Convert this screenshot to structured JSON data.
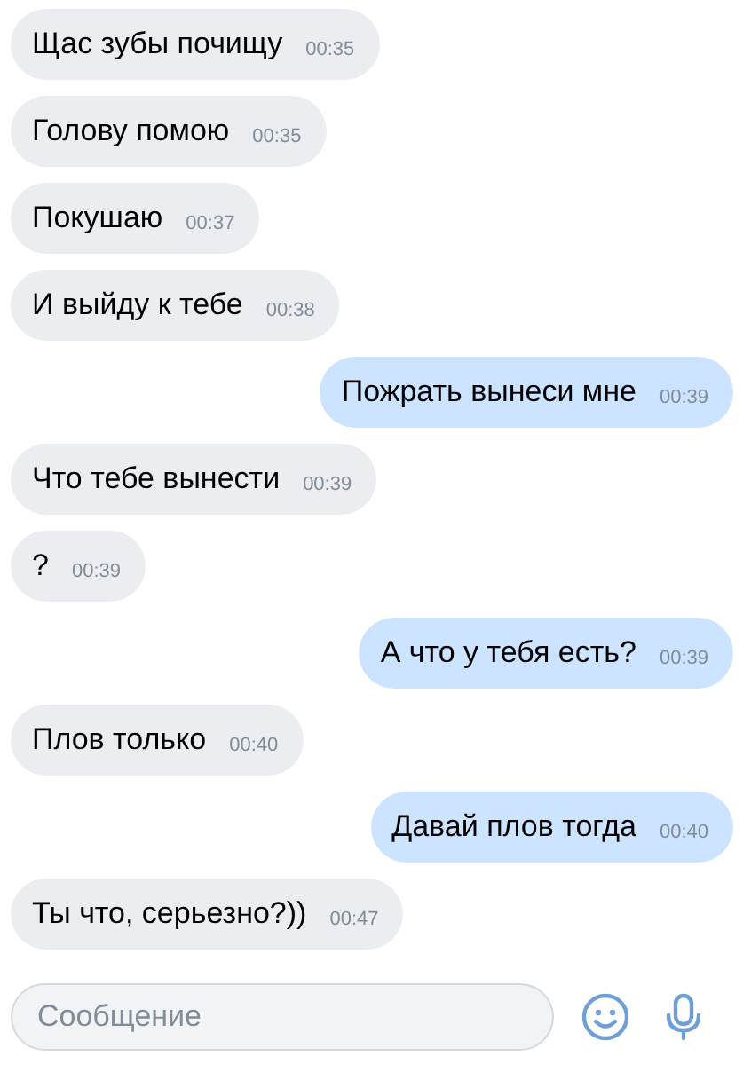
{
  "messages": [
    {
      "kind": "in",
      "text": "Щас зубы почищу",
      "time": "00:35"
    },
    {
      "kind": "in",
      "text": "Голову помою",
      "time": "00:35"
    },
    {
      "kind": "in",
      "text": "Покушаю",
      "time": "00:37"
    },
    {
      "kind": "in",
      "text": "И выйду к тебе",
      "time": "00:38"
    },
    {
      "kind": "out",
      "text": "Пожрать вынеси мне",
      "time": "00:39"
    },
    {
      "kind": "in",
      "text": "Что тебе вынести",
      "time": "00:39"
    },
    {
      "kind": "in",
      "text": "?",
      "time": "00:39"
    },
    {
      "kind": "out",
      "text": "А что у тебя есть?",
      "time": "00:39"
    },
    {
      "kind": "in",
      "text": "Плов только",
      "time": "00:40"
    },
    {
      "kind": "out",
      "text": "Давай плов тогда",
      "time": "00:40"
    },
    {
      "kind": "in",
      "text": "Ты что, серьезно?))",
      "time": "00:47"
    }
  ],
  "composer": {
    "placeholder": "Сообщение"
  }
}
